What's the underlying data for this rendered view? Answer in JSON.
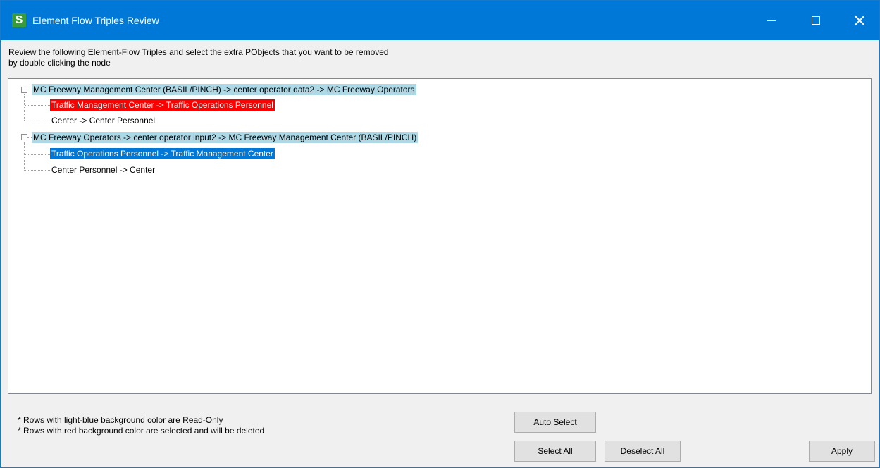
{
  "window": {
    "title": "Element Flow Triples Review",
    "app_icon_letter": "S",
    "controls": [
      "minimize",
      "maximize",
      "close"
    ]
  },
  "instructions": {
    "line1": "Review the following Element-Flow Triples and select the extra PObjects that you want to be removed",
    "line2": "by double clicking the node"
  },
  "tree": {
    "groups": [
      {
        "label": "MC Freeway Management Center (BASIL/PINCH) -> center operator data2 -> MC Freeway Operators",
        "state": "read-only",
        "children": [
          {
            "label": "Traffic Management Center -> Traffic Operations Personnel",
            "state": "selected-for-deletion"
          },
          {
            "label": "Center -> Center Personnel",
            "state": "normal"
          }
        ]
      },
      {
        "label": "MC Freeway Operators -> center operator input2 -> MC Freeway Management Center (BASIL/PINCH)",
        "state": "read-only",
        "children": [
          {
            "label": "Traffic Operations Personnel -> Traffic Management Center",
            "state": "highlighted"
          },
          {
            "label": "Center Personnel -> Center",
            "state": "normal"
          }
        ]
      }
    ]
  },
  "notes": {
    "line1": "* Rows with light-blue background color are Read-Only",
    "line2": "* Rows with red background color are selected and will be deleted"
  },
  "buttons": {
    "auto_select": "Auto Select",
    "select_all": "Select All",
    "deselect_all": "Deselect All",
    "apply": "Apply"
  },
  "colors": {
    "titlebar": "#0078d7",
    "read_only_row": "#add8e6",
    "delete_row": "#ff0000",
    "highlight_row": "#0078d7"
  }
}
